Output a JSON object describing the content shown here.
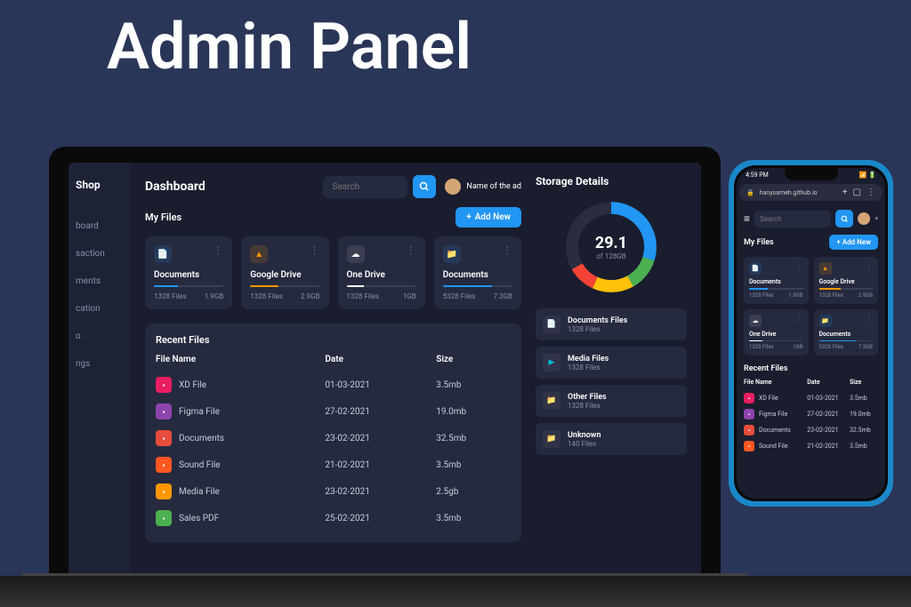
{
  "hero_title": "Admin Panel",
  "brand": "Shop",
  "nav": [
    "board",
    "saction",
    "ments",
    "cation",
    "o",
    "ngs"
  ],
  "header": {
    "title": "Dashboard",
    "search_placeholder": "Search",
    "admin_name": "Name of the ad"
  },
  "my_files": {
    "title": "My Files",
    "add_label": "Add New",
    "cards": [
      {
        "title": "Documents",
        "files": "1328 Files",
        "size": "1.9GB",
        "color": "#2196f3",
        "fill": 35,
        "icon": "📄",
        "iconClass": "ic-blue"
      },
      {
        "title": "Google Drive",
        "files": "1328 Files",
        "size": "2.9GB",
        "color": "#ff9800",
        "fill": 40,
        "icon": "▲",
        "iconClass": "ic-orange"
      },
      {
        "title": "One Drive",
        "files": "1328 Files",
        "size": "1GB",
        "color": "#fff",
        "fill": 25,
        "icon": "☁",
        "iconClass": "ic-white"
      },
      {
        "title": "Documents",
        "files": "5328 Files",
        "size": "7.3GB",
        "color": "#2196f3",
        "fill": 70,
        "icon": "📁",
        "iconClass": "ic-blue"
      }
    ]
  },
  "recent": {
    "title": "Recent Files",
    "headers": [
      "File Name",
      "Date",
      "Size"
    ],
    "rows": [
      {
        "name": "XD File",
        "date": "01-03-2021",
        "size": "3.5mb",
        "color": "#e91e63"
      },
      {
        "name": "Figma File",
        "date": "27-02-2021",
        "size": "19.0mb",
        "color": "#8e44ad"
      },
      {
        "name": "Documents",
        "date": "23-02-2021",
        "size": "32.5mb",
        "color": "#e74c3c"
      },
      {
        "name": "Sound File",
        "date": "21-02-2021",
        "size": "3.5mb",
        "color": "#ff5722"
      },
      {
        "name": "Media File",
        "date": "23-02-2021",
        "size": "2.5gb",
        "color": "#ff9800"
      },
      {
        "name": "Sales PDF",
        "date": "25-02-2021",
        "size": "3.5mb",
        "color": "#4caf50"
      }
    ]
  },
  "storage": {
    "title": "Storage Details",
    "value": "29.1",
    "total": "of 128GB",
    "items": [
      {
        "name": "Documents Files",
        "count": "1328 Files",
        "color": "#2196f3",
        "icon": "📄"
      },
      {
        "name": "Media Files",
        "count": "1328 Files",
        "color": "#00bcd4",
        "icon": "▶"
      },
      {
        "name": "Other Files",
        "count": "1328 Files",
        "color": "#ffc107",
        "icon": "📁"
      },
      {
        "name": "Unknown",
        "count": "140 Files",
        "color": "#f44336",
        "icon": "📁"
      }
    ]
  },
  "phone": {
    "time": "4:59 PM",
    "url": "hanysameh.github.io",
    "search_placeholder": "Search",
    "my_files_title": "My Files",
    "add_label": "Add New",
    "cards": [
      {
        "title": "Documents",
        "files": "1328 Files",
        "size": "1.9GB",
        "color": "#2196f3",
        "fill": 35,
        "icon": "📄",
        "iconClass": "ic-blue"
      },
      {
        "title": "Google Drive",
        "files": "1328 Files",
        "size": "2.9GB",
        "color": "#ff9800",
        "fill": 40,
        "icon": "▲",
        "iconClass": "ic-orange"
      },
      {
        "title": "One Drive",
        "files": "1328 Files",
        "size": "1GB",
        "color": "#fff",
        "fill": 25,
        "icon": "☁",
        "iconClass": "ic-white"
      },
      {
        "title": "Documents",
        "files": "5328 Files",
        "size": "7.3GB",
        "color": "#2196f3",
        "fill": 70,
        "icon": "📁",
        "iconClass": "ic-blue"
      }
    ],
    "recent_title": "Recent Files",
    "headers": [
      "File Name",
      "Date",
      "Size"
    ],
    "rows": [
      {
        "name": "XD File",
        "date": "01-03-2021",
        "size": "3.5mb",
        "color": "#e91e63"
      },
      {
        "name": "Figma File",
        "date": "27-02-2021",
        "size": "19.0mb",
        "color": "#8e44ad"
      },
      {
        "name": "Documents",
        "date": "23-02-2021",
        "size": "32.5mb",
        "color": "#e74c3c"
      },
      {
        "name": "Sound File",
        "date": "21-02-2021",
        "size": "3.5mb",
        "color": "#ff5722"
      }
    ]
  }
}
